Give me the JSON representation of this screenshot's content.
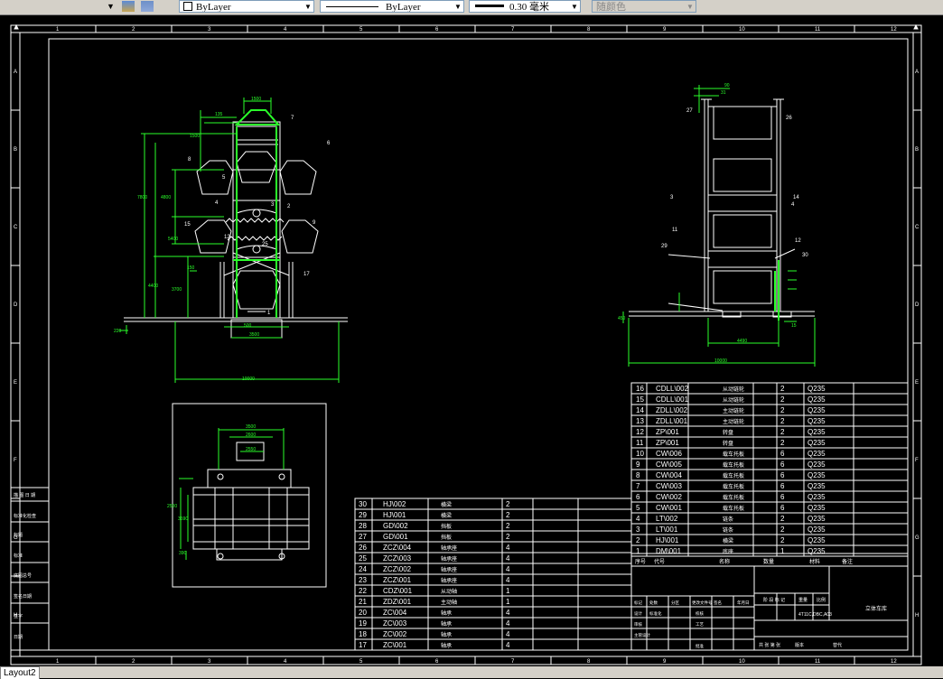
{
  "toolbar": {
    "layer_select": "ByLayer",
    "linetype_select": "ByLayer",
    "lineweight_select": "0.30 毫米",
    "color_select": "随颜色"
  },
  "frame": {
    "top_numbers": [
      "1",
      "2",
      "3",
      "4",
      "5",
      "6",
      "7",
      "8",
      "9",
      "10",
      "11",
      "12"
    ],
    "side_letters": [
      "A",
      "B",
      "C",
      "D",
      "E",
      "F",
      "G",
      "H"
    ]
  },
  "left_revision_rows": [
    "描 图 日 期",
    "标准化检查",
    "标题",
    "标准",
    "底图总号",
    "签名日期",
    "签字",
    "日期"
  ],
  "bom_right": [
    [
      "16",
      "CDLL\\002",
      "从动链轮",
      "2",
      "Q235"
    ],
    [
      "15",
      "CDLL\\001",
      "从动链轮",
      "2",
      "Q235"
    ],
    [
      "14",
      "ZDLL\\002",
      "主动链轮",
      "2",
      "Q235"
    ],
    [
      "13",
      "ZDLL\\001",
      "主动链轮",
      "2",
      "Q235"
    ],
    [
      "12",
      "ZP\\001",
      "转盘",
      "2",
      "Q235"
    ],
    [
      "11",
      "ZP\\001",
      "转盘",
      "2",
      "Q235"
    ],
    [
      "10",
      "CW\\006",
      "载车托板",
      "6",
      "Q235"
    ],
    [
      "9",
      "CW\\005",
      "载车托板",
      "6",
      "Q235"
    ],
    [
      "8",
      "CW\\004",
      "载车托板",
      "6",
      "Q235"
    ],
    [
      "7",
      "CW\\003",
      "载车托板",
      "6",
      "Q235"
    ],
    [
      "6",
      "CW\\002",
      "载车托板",
      "6",
      "Q235"
    ],
    [
      "5",
      "CW\\001",
      "载车托板",
      "6",
      "Q235"
    ],
    [
      "4",
      "LT\\002",
      "链条",
      "2",
      "Q235"
    ],
    [
      "3",
      "LT\\001",
      "链条",
      "2",
      "Q235"
    ],
    [
      "2",
      "HJ\\001",
      "横梁",
      "2",
      "Q235"
    ],
    [
      "1",
      "DM\\001",
      "底座",
      "1",
      "Q235"
    ]
  ],
  "bom_right_header": [
    "序号",
    "代号",
    "名称",
    "数量",
    "材料",
    "备注"
  ],
  "bom_left": [
    [
      "30",
      "HJ\\002",
      "横梁",
      "2"
    ],
    [
      "29",
      "HJ\\001",
      "横梁",
      "2"
    ],
    [
      "28",
      "GD\\002",
      "挡板",
      "2"
    ],
    [
      "27",
      "GD\\001",
      "挡板",
      "2"
    ],
    [
      "26",
      "ZCZ\\004",
      "轴承座",
      "4"
    ],
    [
      "25",
      "ZCZ\\003",
      "轴承座",
      "4"
    ],
    [
      "24",
      "ZCZ\\002",
      "轴承座",
      "4"
    ],
    [
      "23",
      "ZCZ\\001",
      "轴承座",
      "4"
    ],
    [
      "22",
      "CDZ\\001",
      "从动轴",
      "1"
    ],
    [
      "21",
      "ZDZ\\001",
      "主动轴",
      "1"
    ],
    [
      "20",
      "ZC\\004",
      "轴承",
      "4"
    ],
    [
      "19",
      "ZC\\003",
      "轴承",
      "4"
    ],
    [
      "18",
      "ZC\\002",
      "轴承",
      "4"
    ],
    [
      "17",
      "ZC\\001",
      "轴承",
      "4"
    ]
  ],
  "title_block": {
    "name": "立体车库",
    "scale_labels": [
      "阶 段 标 记",
      "重量",
      "比例"
    ],
    "code": "4T11C,DBC,A03",
    "sheet_info": "共 张 第 张",
    "revision_labels": [
      "标记",
      "处数",
      "分区",
      "更改文件号",
      "签名",
      "年月日"
    ],
    "roles": [
      "设计",
      "标准化",
      "校核",
      "工艺",
      "主管设计",
      "审核",
      "批准"
    ],
    "extra_labels": [
      "版本",
      "替代"
    ]
  },
  "dims_front": {
    "d1500": "1500",
    "d135": "135",
    "d1500b": "1500",
    "d7800": "7800",
    "d4800": "4800",
    "d5400": "5400",
    "d4400": "4400",
    "d3700": "3700",
    "d150": "150",
    "d500": "500",
    "d3500": "3500",
    "d10000": "10000",
    "d500b": "500",
    "d220": "220"
  },
  "dims_side": {
    "d90": "90",
    "d31": "31",
    "d4490": "4490",
    "d10000": "10000",
    "d450": "450",
    "d15": "15"
  },
  "dims_top": {
    "d3500": "3500",
    "d2600": "2600",
    "d2550": "2550",
    "d2500": "2500",
    "d3590": "3590",
    "d390": "390"
  },
  "balloons_front": [
    "7",
    "6",
    "8",
    "9",
    "15",
    "12",
    "17",
    "25",
    "1",
    "3",
    "2",
    "4",
    "5"
  ],
  "balloons_side": [
    "27",
    "26",
    "3",
    "14",
    "11",
    "12",
    "29",
    "30",
    "4"
  ],
  "layout_tab": "Layout2"
}
